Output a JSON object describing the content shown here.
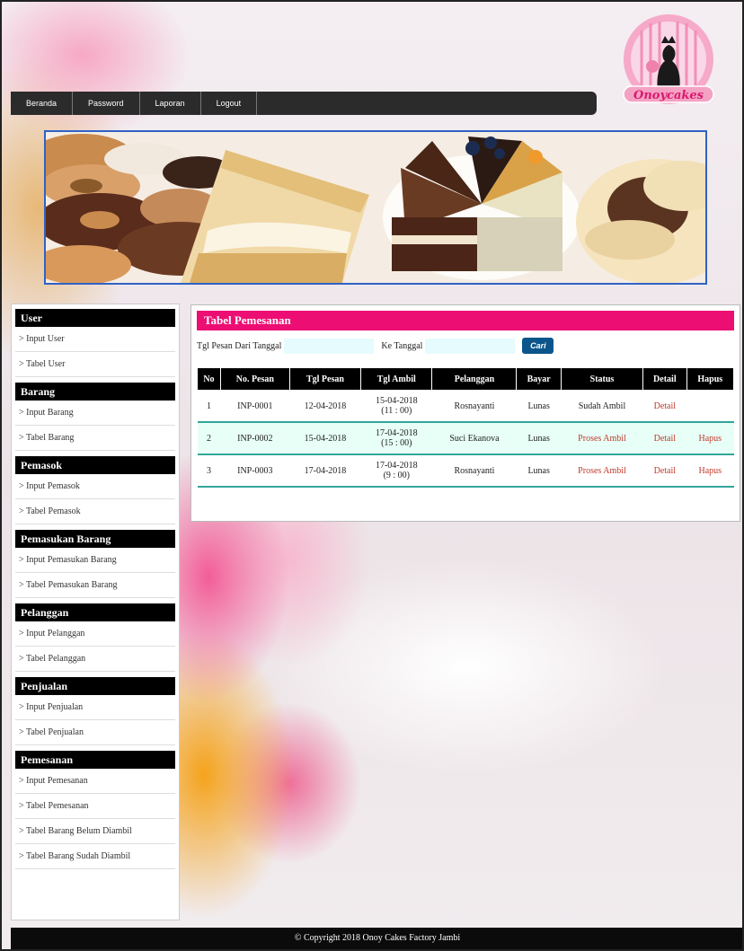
{
  "nav": [
    "Beranda",
    "Password",
    "Laporan",
    "Logout"
  ],
  "logo_text": "Onoycakes",
  "sidebar": [
    {
      "title": "User",
      "items": [
        "> Input User",
        "> Tabel User"
      ]
    },
    {
      "title": "Barang",
      "items": [
        "> Input Barang",
        "> Tabel Barang"
      ]
    },
    {
      "title": "Pemasok",
      "items": [
        "> Input Pemasok",
        "> Tabel Pemasok"
      ]
    },
    {
      "title": "Pemasukan Barang",
      "items": [
        "> Input Pemasukan Barang",
        "> Tabel Pemasukan Barang"
      ]
    },
    {
      "title": "Pelanggan",
      "items": [
        "> Input Pelanggan",
        "> Tabel Pelanggan"
      ]
    },
    {
      "title": "Penjualan",
      "items": [
        "> Input Penjualan",
        "> Tabel Penjualan"
      ]
    },
    {
      "title": "Pemesanan",
      "items": [
        "> Input Pemesanan",
        "> Tabel Pemesanan",
        "> Tabel Barang Belum Diambil",
        "> Tabel Barang Sudah Diambil"
      ]
    }
  ],
  "main": {
    "title": "Tabel Pemesanan",
    "filter": {
      "from_label": "Tgl Pesan Dari Tanggal",
      "to_label": "Ke Tanggal",
      "from_value": "",
      "to_value": "",
      "button": "Cari"
    },
    "columns": [
      "No",
      "No. Pesan",
      "Tgl Pesan",
      "Tgl Ambil",
      "Pelanggan",
      "Bayar",
      "Status",
      "Detail",
      "Hapus"
    ],
    "rows": [
      {
        "no": "1",
        "no_pesan": "INP-0001",
        "tgl_pesan": "12-04-2018",
        "tgl_ambil": "15-04-2018",
        "jam": "(11 : 00)",
        "pelanggan": "Rosnayanti",
        "bayar": "Lunas",
        "status": "Sudah Ambil",
        "detail": "Detail",
        "hapus": ""
      },
      {
        "no": "2",
        "no_pesan": "INP-0002",
        "tgl_pesan": "15-04-2018",
        "tgl_ambil": "17-04-2018",
        "jam": "(15 : 00)",
        "pelanggan": "Suci Ekanova",
        "bayar": "Lunas",
        "status": "Proses Ambil",
        "detail": "Detail",
        "hapus": "Hapus"
      },
      {
        "no": "3",
        "no_pesan": "INP-0003",
        "tgl_pesan": "17-04-2018",
        "tgl_ambil": "17-04-2018",
        "jam": "(9 : 00)",
        "pelanggan": "Rosnayanti",
        "bayar": "Lunas",
        "status": "Proses Ambil",
        "detail": "Detail",
        "hapus": "Hapus"
      }
    ]
  },
  "footer": "© Copyright 2018 Onoy Cakes Factory Jambi",
  "colors": {
    "title_bar": "#ed0e73",
    "row_alt": "#e7fff6",
    "row_border": "#31a69a",
    "link": "#c0392b",
    "button": "#0b558a",
    "banner_border": "#2f62c5"
  }
}
